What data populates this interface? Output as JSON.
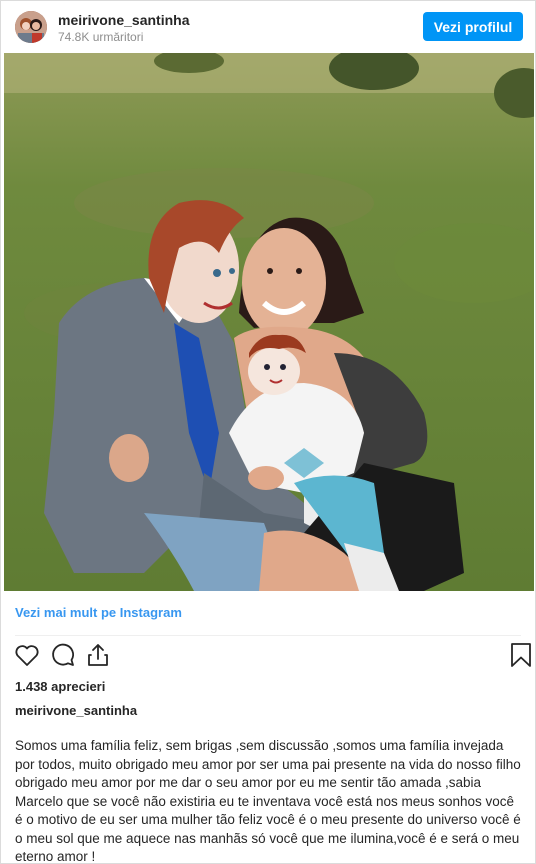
{
  "header": {
    "username": "meirivone_santinha",
    "followers": "74.8K urmăritori",
    "profile_button": "Vezi profilul"
  },
  "post": {
    "more_link": "Vezi mai mult pe Instagram",
    "likes": "1.438 aprecieri",
    "caption_user": "meirivone_santinha",
    "caption": "Somos uma família feliz, sem brigas ,sem discussão ,somos uma família invejada por todos, muito obrigado meu amor por ser uma pai presente na vida do nosso filho obrigado meu amor por me dar o seu amor por eu me sentir tão amada ,sabia Marcelo que se você não existiria eu te inventava você está nos meus sonhos você é o motivo de eu ser uma mulher tão feliz você é o meu presente do universo você é o meu sol que me aquece nas manhãs só você que me ilumina,você é e será o meu eterno amor !"
  },
  "icons": [
    "heart-icon",
    "comment-icon",
    "share-icon",
    "bookmark-icon"
  ],
  "colors": {
    "accent": "#0095f6",
    "link": "#3897f0",
    "text": "#262626",
    "muted": "#8e8e8e"
  }
}
